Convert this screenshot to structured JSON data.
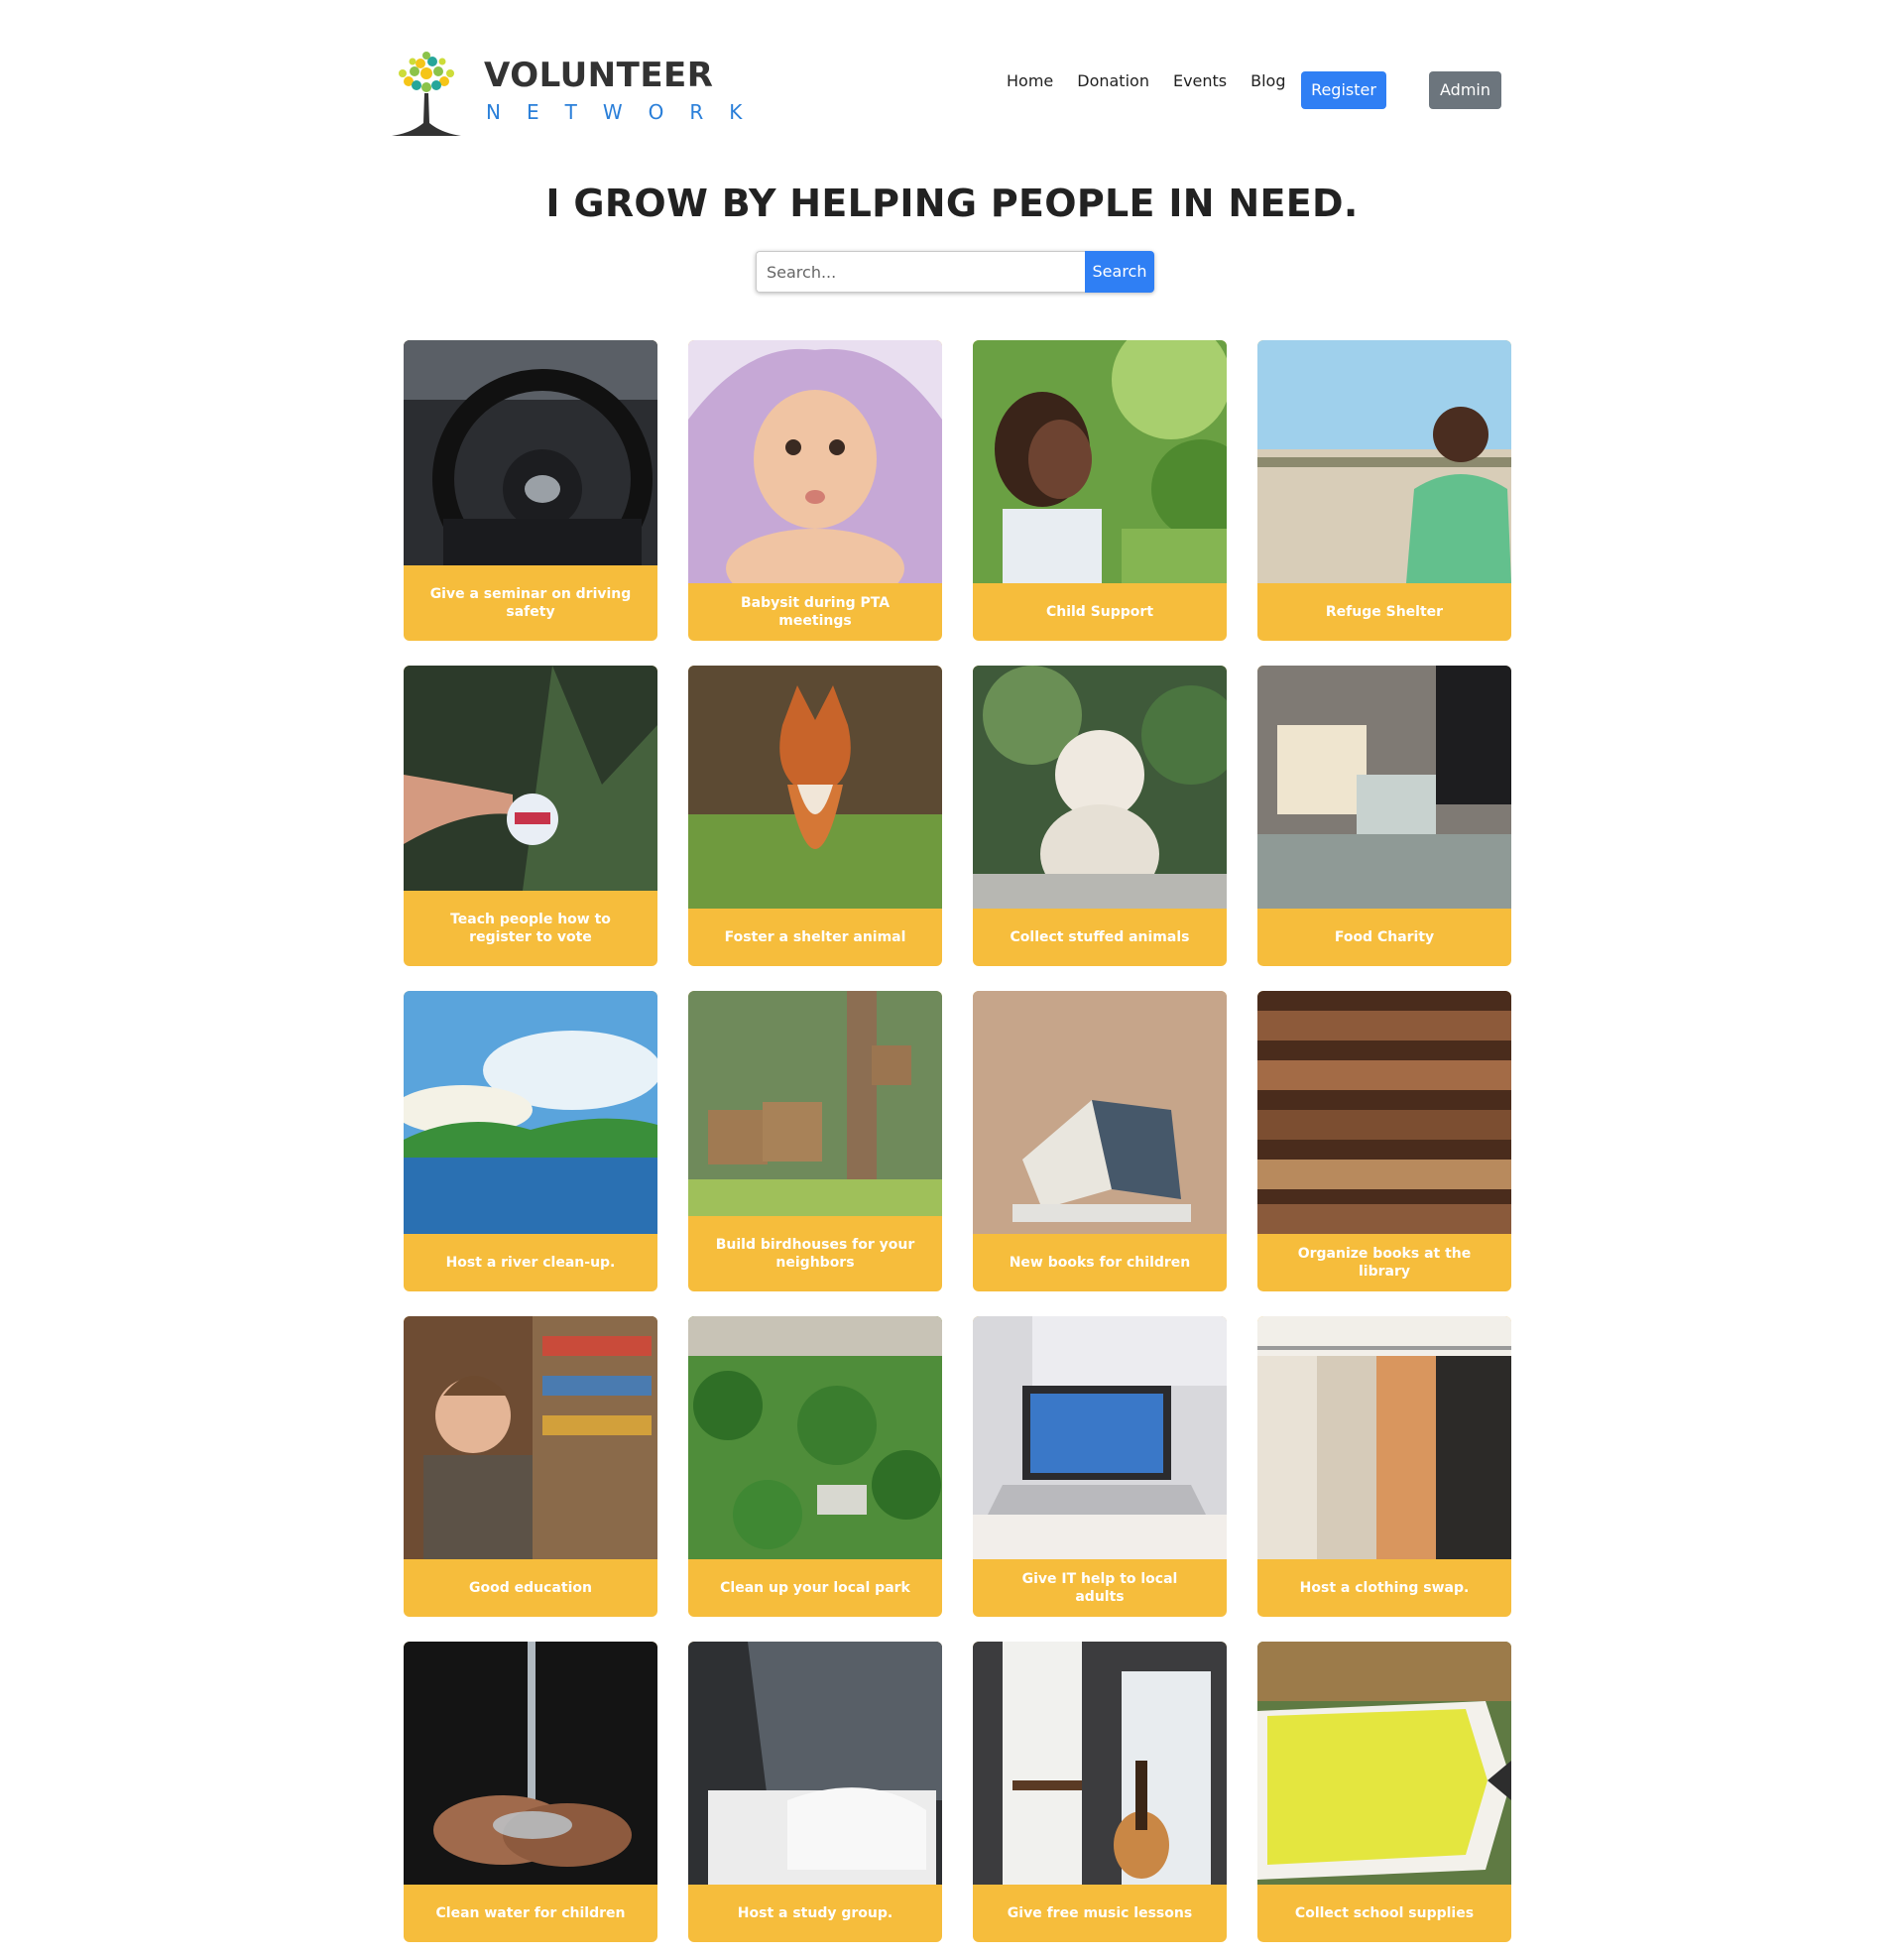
{
  "logo": {
    "word": "VOLUNTEER",
    "sub": "NETWORK"
  },
  "nav": {
    "home": "Home",
    "donation": "Donation",
    "events": "Events",
    "blog": "Blog",
    "register": "Register",
    "admin": "Admin"
  },
  "hero": {
    "title": "I GROW BY HELPING PEOPLE IN NEED."
  },
  "search": {
    "placeholder": "Search...",
    "button": "Search"
  },
  "colors": {
    "accent": "#2f7ff4",
    "card": "#f6bd3c",
    "admin": "#6c757d"
  },
  "cards": [
    {
      "label": "Give a seminar on driving safety",
      "image": "steering-wheel-photo"
    },
    {
      "label": "Babysit during PTA meetings",
      "image": "baby-photo"
    },
    {
      "label": "Child Support",
      "image": "smiling-girl-photo"
    },
    {
      "label": "Refuge Shelter",
      "image": "boy-in-field-photo"
    },
    {
      "label": "Teach people how to register to vote",
      "image": "i-voted-sticker-photo"
    },
    {
      "label": "Foster a shelter animal",
      "image": "fox-photo"
    },
    {
      "label": "Collect stuffed animals",
      "image": "white-dog-photo"
    },
    {
      "label": "Food Charity",
      "image": "food-sorting-photo"
    },
    {
      "label": "Host a river clean-up.",
      "image": "river-photo"
    },
    {
      "label": "Build birdhouses for your neighbors",
      "image": "birdhouse-photo"
    },
    {
      "label": "New books for children",
      "image": "open-book-photo"
    },
    {
      "label": "Organize books at the library",
      "image": "bookshelves-photo"
    },
    {
      "label": "Good education",
      "image": "boy-reading-photo"
    },
    {
      "label": "Clean up your local park",
      "image": "park-aerial-photo"
    },
    {
      "label": "Give IT help to local adults",
      "image": "laptop-photo"
    },
    {
      "label": "Host a clothing swap.",
      "image": "clothes-rack-photo"
    },
    {
      "label": "Clean water for children",
      "image": "hands-water-photo"
    },
    {
      "label": "Host a study group.",
      "image": "study-papers-photo"
    },
    {
      "label": "Give free music lessons",
      "image": "guitar-room-photo"
    },
    {
      "label": "Collect school supplies",
      "image": "love-to-learn-sign-photo"
    }
  ]
}
